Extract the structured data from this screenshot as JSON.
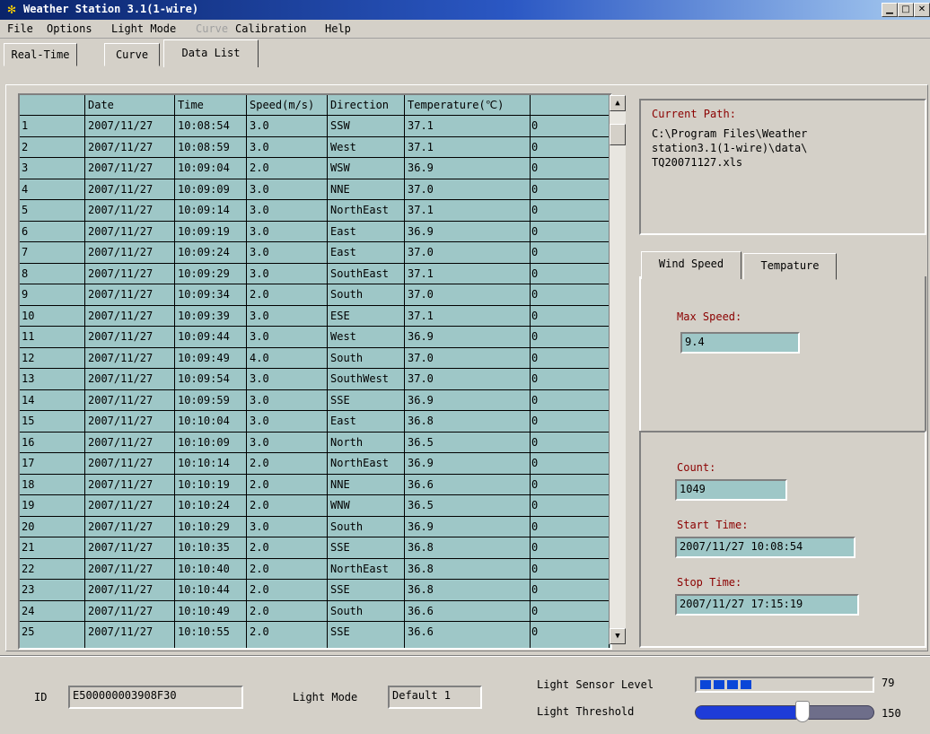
{
  "window": {
    "title": "Weather Station 3.1(1-wire)"
  },
  "menu": [
    {
      "label": "File",
      "enabled": true
    },
    {
      "label": "Options",
      "enabled": true
    },
    {
      "label": "Light Mode",
      "enabled": true
    },
    {
      "label": "Curve",
      "enabled": false
    },
    {
      "label": "Calibration",
      "enabled": true
    },
    {
      "label": "Help",
      "enabled": true
    }
  ],
  "tabs": {
    "items": [
      "Real-Time",
      "Curve",
      "Data List"
    ],
    "active": "Data List"
  },
  "table": {
    "headers": [
      "",
      "Date",
      "Time",
      "Speed(m/s)",
      "Direction",
      "Temperature(℃)",
      ""
    ],
    "rows": [
      [
        "1",
        "2007/11/27",
        "10:08:54",
        "3.0",
        "SSW",
        "37.1",
        "0"
      ],
      [
        "2",
        "2007/11/27",
        "10:08:59",
        "3.0",
        "West",
        "37.1",
        "0"
      ],
      [
        "3",
        "2007/11/27",
        "10:09:04",
        "2.0",
        "WSW",
        "36.9",
        "0"
      ],
      [
        "4",
        "2007/11/27",
        "10:09:09",
        "3.0",
        "NNE",
        "37.0",
        "0"
      ],
      [
        "5",
        "2007/11/27",
        "10:09:14",
        "3.0",
        "NorthEast",
        "37.1",
        "0"
      ],
      [
        "6",
        "2007/11/27",
        "10:09:19",
        "3.0",
        "East",
        "36.9",
        "0"
      ],
      [
        "7",
        "2007/11/27",
        "10:09:24",
        "3.0",
        "East",
        "37.0",
        "0"
      ],
      [
        "8",
        "2007/11/27",
        "10:09:29",
        "3.0",
        "SouthEast",
        "37.1",
        "0"
      ],
      [
        "9",
        "2007/11/27",
        "10:09:34",
        "2.0",
        "South",
        "37.0",
        "0"
      ],
      [
        "10",
        "2007/11/27",
        "10:09:39",
        "3.0",
        "ESE",
        "37.1",
        "0"
      ],
      [
        "11",
        "2007/11/27",
        "10:09:44",
        "3.0",
        "West",
        "36.9",
        "0"
      ],
      [
        "12",
        "2007/11/27",
        "10:09:49",
        "4.0",
        "South",
        "37.0",
        "0"
      ],
      [
        "13",
        "2007/11/27",
        "10:09:54",
        "3.0",
        "SouthWest",
        "37.0",
        "0"
      ],
      [
        "14",
        "2007/11/27",
        "10:09:59",
        "3.0",
        "SSE",
        "36.9",
        "0"
      ],
      [
        "15",
        "2007/11/27",
        "10:10:04",
        "3.0",
        "East",
        "36.8",
        "0"
      ],
      [
        "16",
        "2007/11/27",
        "10:10:09",
        "3.0",
        "North",
        "36.5",
        "0"
      ],
      [
        "17",
        "2007/11/27",
        "10:10:14",
        "2.0",
        "NorthEast",
        "36.9",
        "0"
      ],
      [
        "18",
        "2007/11/27",
        "10:10:19",
        "2.0",
        "NNE",
        "36.6",
        "0"
      ],
      [
        "19",
        "2007/11/27",
        "10:10:24",
        "2.0",
        "WNW",
        "36.5",
        "0"
      ],
      [
        "20",
        "2007/11/27",
        "10:10:29",
        "3.0",
        "South",
        "36.9",
        "0"
      ],
      [
        "21",
        "2007/11/27",
        "10:10:35",
        "2.0",
        "SSE",
        "36.8",
        "0"
      ],
      [
        "22",
        "2007/11/27",
        "10:10:40",
        "2.0",
        "NorthEast",
        "36.8",
        "0"
      ],
      [
        "23",
        "2007/11/27",
        "10:10:44",
        "2.0",
        "SSE",
        "36.8",
        "0"
      ],
      [
        "24",
        "2007/11/27",
        "10:10:49",
        "2.0",
        "South",
        "36.6",
        "0"
      ],
      [
        "25",
        "2007/11/27",
        "10:10:55",
        "2.0",
        "SSE",
        "36.6",
        "0"
      ]
    ]
  },
  "path": {
    "label": "Current Path:",
    "lines": [
      "C:\\Program Files\\Weather",
      "station3.1(1-wire)\\data\\",
      "TQ20071127.xls"
    ]
  },
  "stats_tabs": {
    "items": [
      "Wind Speed",
      "Tempature"
    ],
    "active": "Wind Speed"
  },
  "max_speed": {
    "label": "Max Speed:",
    "value": "9.4"
  },
  "count": {
    "label": "Count:",
    "value": "1049"
  },
  "start_time": {
    "label": "Start Time:",
    "value": "2007/11/27 10:08:54"
  },
  "stop_time": {
    "label": "Stop Time:",
    "value": "2007/11/27 17:15:19"
  },
  "bottom": {
    "id_label": "ID",
    "id_value": "E500000003908F30",
    "light_mode_label": "Light Mode",
    "light_mode_value": "Default 1",
    "sensor_label": "Light Sensor Level",
    "sensor_value": "79",
    "threshold_label": "Light Threshold",
    "threshold_value": "150",
    "sensor_segments_lit": 4,
    "threshold_fraction": 0.6
  },
  "colors": {
    "grid_bg": "#9ec7c7",
    "label_red": "#8b0000",
    "title_bar": "#0a246a"
  },
  "icons": {
    "app": "weather-station-icon",
    "scroll_up": "scroll-up-arrow",
    "scroll_down": "scroll-down-arrow"
  }
}
